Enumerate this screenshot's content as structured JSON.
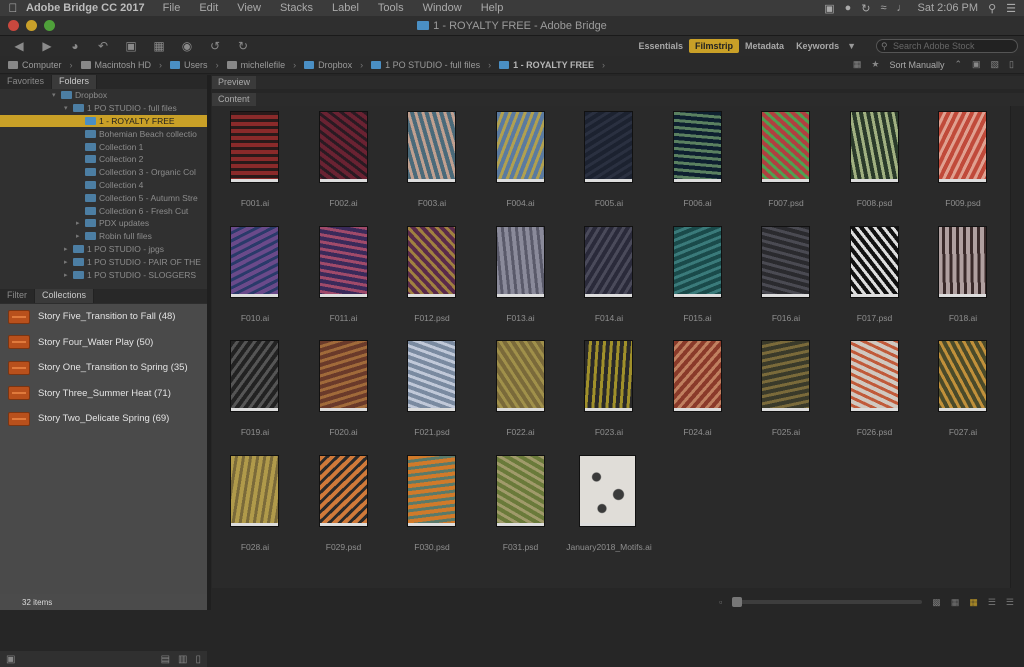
{
  "menubar": {
    "app": "Adobe Bridge CC 2017",
    "items": [
      "File",
      "Edit",
      "View",
      "Stacks",
      "Label",
      "Tools",
      "Window",
      "Help"
    ],
    "clock": "Sat 2:06 PM"
  },
  "window": {
    "title": "1 - ROYALTY FREE - Adobe Bridge"
  },
  "workspaces": {
    "items": [
      "Essentials",
      "Filmstrip",
      "Metadata",
      "Keywords"
    ],
    "active": "Filmstrip",
    "search_placeholder": "Search Adobe Stock"
  },
  "path": {
    "crumbs": [
      "Computer",
      "Macintosh HD",
      "Users",
      "michellefile",
      "Dropbox",
      "1 PO STUDIO - full files",
      "1 - ROYALTY FREE"
    ],
    "sort": "Sort Manually"
  },
  "left": {
    "tabs": [
      "Favorites",
      "Folders"
    ],
    "tree": [
      {
        "label": "Dropbox",
        "indent": 0
      },
      {
        "label": "1 PO STUDIO - full files",
        "indent": 1
      },
      {
        "label": "1 - ROYALTY FREE",
        "indent": 2,
        "selected": true
      },
      {
        "label": "Bohemian Beach collectio",
        "indent": 2
      },
      {
        "label": "Collection 1",
        "indent": 2
      },
      {
        "label": "Collection 2",
        "indent": 2
      },
      {
        "label": "Collection 3 - Organic Col",
        "indent": 2
      },
      {
        "label": "Collection 4",
        "indent": 2
      },
      {
        "label": "Collection 5 - Autumn Stre",
        "indent": 2
      },
      {
        "label": "Collection 6 - Fresh Cut",
        "indent": 2
      },
      {
        "label": "PDX updates",
        "indent": 2
      },
      {
        "label": "Robin full files",
        "indent": 2
      },
      {
        "label": "1 PO STUDIO - jpgs",
        "indent": 1
      },
      {
        "label": "1 PO STUDIO - PAIR OF THE",
        "indent": 1
      },
      {
        "label": "1 PO STUDIO - SLOGGERS",
        "indent": 1
      }
    ],
    "coll_tabs": [
      "Filter",
      "Collections"
    ],
    "collections": [
      "Story Five_Transition to Fall (48)",
      "Story Four_Water Play (50)",
      "Story One_Transition to Spring (35)",
      "Story Three_Summer Heat (71)",
      "Story Two_Delicate Spring (69)"
    ],
    "status": "32 items"
  },
  "panels": {
    "preview": "Preview",
    "content": "Content"
  },
  "files": [
    {
      "name": "F001.ai",
      "c1": "#8a2a2a",
      "c2": "#2a1a1a"
    },
    {
      "name": "F002.ai",
      "c1": "#6a2232",
      "c2": "#2a1a22"
    },
    {
      "name": "F003.ai",
      "c1": "#4a6a7a",
      "c2": "#c0a090"
    },
    {
      "name": "F004.ai",
      "c1": "#5a7aa0",
      "c2": "#b0a050"
    },
    {
      "name": "F005.ai",
      "c1": "#1c2230",
      "c2": "#2a3040"
    },
    {
      "name": "F006.ai",
      "c1": "#0e2030",
      "c2": "#5a8060"
    },
    {
      "name": "F007.psd",
      "c1": "#b04040",
      "c2": "#50a050"
    },
    {
      "name": "F008.psd",
      "c1": "#2a3a2a",
      "c2": "#a0b080"
    },
    {
      "name": "F009.psd",
      "c1": "#c04a3a",
      "c2": "#e0a090"
    },
    {
      "name": "F010.ai",
      "c1": "#6a4a8a",
      "c2": "#2a3a6a"
    },
    {
      "name": "F011.ai",
      "c1": "#3a2a5a",
      "c2": "#a04a6a"
    },
    {
      "name": "F012.psd",
      "c1": "#5a2a4a",
      "c2": "#a08040"
    },
    {
      "name": "F013.ai",
      "c1": "#8a8a9a",
      "c2": "#5a5a6a"
    },
    {
      "name": "F014.ai",
      "c1": "#2a2a3a",
      "c2": "#4a4a5a"
    },
    {
      "name": "F015.ai",
      "c1": "#1a4a4a",
      "c2": "#3a7a7a"
    },
    {
      "name": "F016.ai",
      "c1": "#2a2a2e",
      "c2": "#4a4a52"
    },
    {
      "name": "F017.psd",
      "c1": "#111111",
      "c2": "#dddddd"
    },
    {
      "name": "F018.ai",
      "c1": "#b0a0a0",
      "c2": "#3a2a2a"
    },
    {
      "name": "F019.ai",
      "c1": "#222222",
      "c2": "#555555"
    },
    {
      "name": "F020.ai",
      "c1": "#6a3a2a",
      "c2": "#a06a3a"
    },
    {
      "name": "F021.psd",
      "c1": "#7a8aa0",
      "c2": "#c0c8d8"
    },
    {
      "name": "F022.ai",
      "c1": "#7a6a3a",
      "c2": "#a0904a"
    },
    {
      "name": "F023.ai",
      "c1": "#2a2a2a",
      "c2": "#a0902a"
    },
    {
      "name": "F024.ai",
      "c1": "#8a3a2a",
      "c2": "#c08060"
    },
    {
      "name": "F025.ai",
      "c1": "#3a3a2a",
      "c2": "#7a6a3a"
    },
    {
      "name": "F026.psd",
      "c1": "#d0c8c0",
      "c2": "#c05a3a"
    },
    {
      "name": "F027.ai",
      "c1": "#4a4a2a",
      "c2": "#c0903a"
    },
    {
      "name": "F028.ai",
      "c1": "#b09a4a",
      "c2": "#7a6a3a"
    },
    {
      "name": "F029.psd",
      "c1": "#d07a3a",
      "c2": "#2a2a2a"
    },
    {
      "name": "F030.psd",
      "c1": "#d07a2a",
      "c2": "#5a7a6a"
    },
    {
      "name": "F031.psd",
      "c1": "#6a7a3a",
      "c2": "#a09a6a"
    },
    {
      "name": "January2018_Motifs.ai",
      "c1": "#e0ddd8",
      "c2": "#3a3a3a",
      "wide": true
    }
  ],
  "accent": "#c9a027",
  "collection_color": "#b8501c"
}
